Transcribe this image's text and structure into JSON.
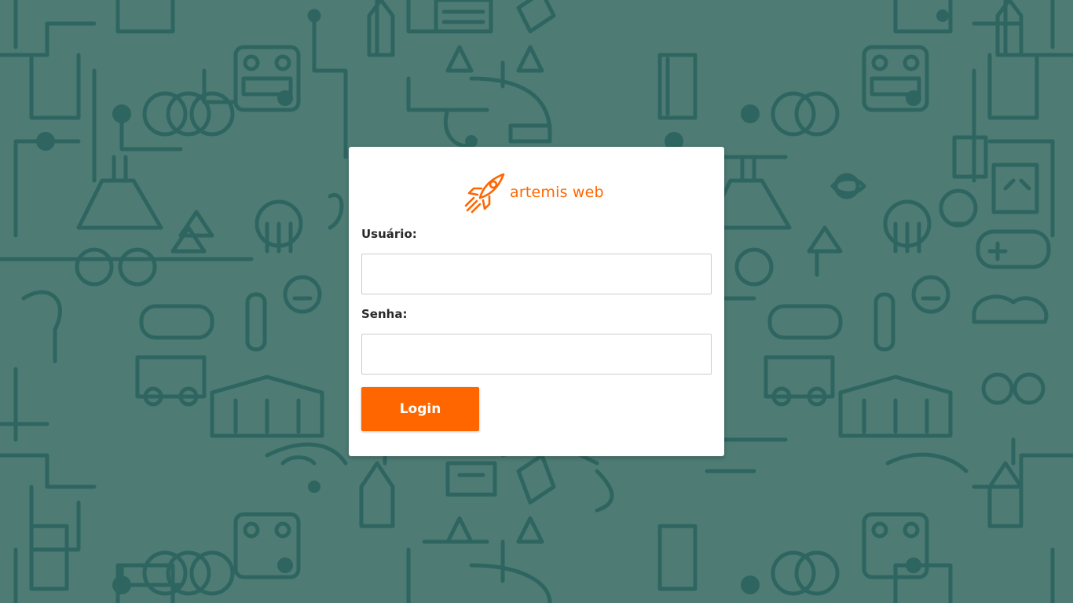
{
  "brand": {
    "name": "artemis web",
    "icon": "rocket-icon",
    "color": "#ff6600"
  },
  "colors": {
    "background": "#4e7c74",
    "pattern_line": "#2f6560",
    "card": "#ffffff",
    "accent": "#ff6600"
  },
  "form": {
    "username_label": "Usuário:",
    "username_value": "",
    "password_label": "Senha:",
    "password_value": "",
    "login_button": "Login"
  }
}
